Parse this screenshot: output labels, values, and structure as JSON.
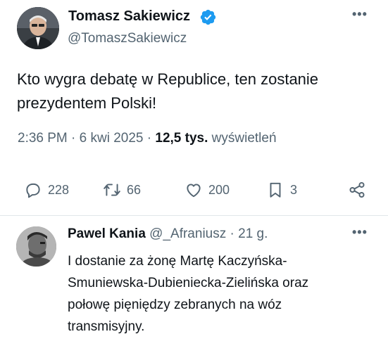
{
  "tweet": {
    "author_name": "Tomasz Sakiewicz",
    "author_handle": "@TomaszSakiewicz",
    "more_label": "•••",
    "text_line1": "Kto wygra debatę w Republice, ten zostanie",
    "text_line2": "prezydentem Polski!",
    "time": "2:36 PM",
    "date": "6 kwi 2025",
    "views_count": "12,5 tys.",
    "views_label": "wyświetleń",
    "separator": "·",
    "replies": "228",
    "reposts": "66",
    "likes": "200",
    "bookmarks": "3"
  },
  "reply": {
    "author_name": "Pawel Kania",
    "author_handle": "@_Afraniusz",
    "time_ago": "21 g.",
    "separator": "·",
    "more_label": "•••",
    "line1": "I dostanie za żonę Martę Kaczyńska-",
    "line2": "Smuniewska-Dubieniecka-Zielińska oraz",
    "line3": "połowę pięniędzy zebranych na wóz",
    "line4": "transmisyjny."
  },
  "colors": {
    "text": "#0f1419",
    "secondary": "#536471",
    "verified": "#1d9bf0",
    "divider": "#e1e6ea"
  },
  "icons": [
    "verified-badge-icon",
    "reply-icon",
    "repost-icon",
    "like-icon",
    "bookmark-icon",
    "share-icon",
    "more-icon"
  ]
}
